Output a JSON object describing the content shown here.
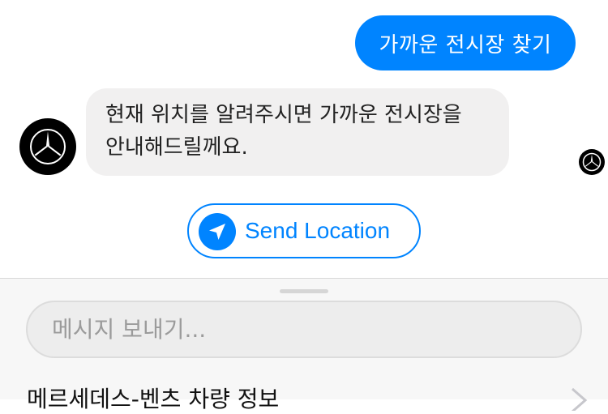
{
  "chat": {
    "outgoing_message": "가까운 전시장 찾기",
    "incoming_message_lines": [
      "현재 위치를 알려주시면 가까운 전시장을",
      "안내해드릴께요."
    ],
    "quick_reply": {
      "label": "Send Location",
      "icon": "location-arrow-icon"
    },
    "accent_color": "#0084ff",
    "incoming_bubble_color": "#f1f0f0",
    "avatar": {
      "icon": "mercedes-star-logo",
      "background": "#000000"
    }
  },
  "composer": {
    "placeholder": "메시지 보내기...",
    "value": ""
  },
  "menu": {
    "title": "메르세데스-벤츠 차량 정보",
    "chevron_icon": "chevron-right-icon"
  }
}
